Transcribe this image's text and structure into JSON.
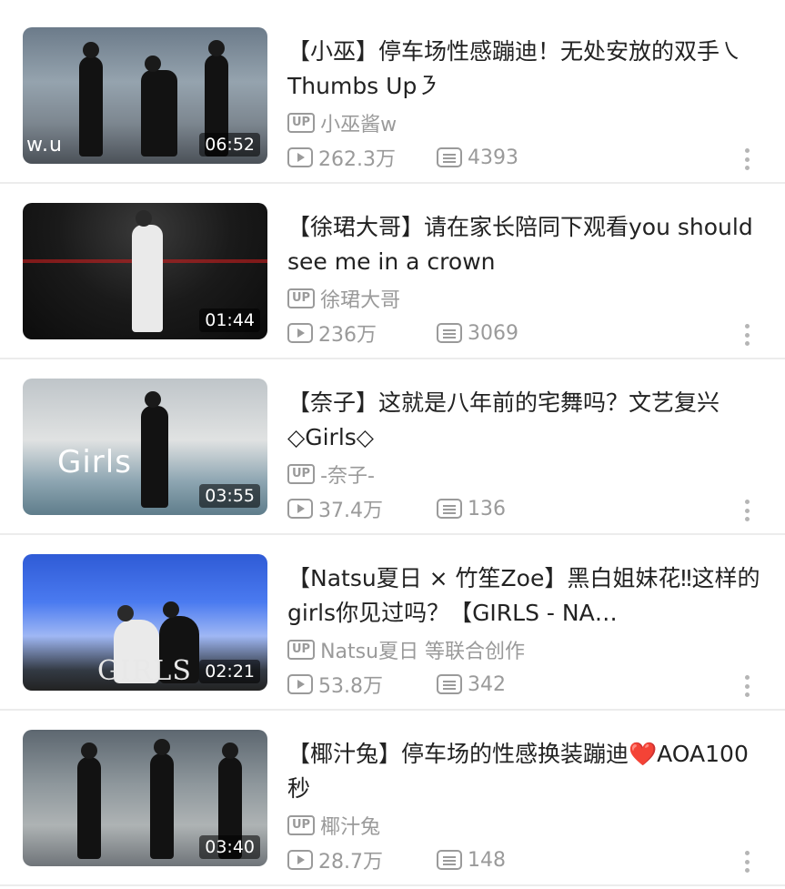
{
  "videos": [
    {
      "title": "【小巫】停车场性感蹦迪！无处安放的双手㇏Thumbs Up㇋",
      "uploader": "小巫酱w",
      "views": "262.3万",
      "danmaku": "4393",
      "duration": "06:52",
      "overlay": "w.u"
    },
    {
      "title": "【徐珺大哥】请在家长陪同下观看you should see me in a crown",
      "uploader": "徐珺大哥",
      "views": "236万",
      "danmaku": "3069",
      "duration": "01:44",
      "overlay": ""
    },
    {
      "title": "【奈子】这就是八年前的宅舞吗？文艺复兴◇Girls◇",
      "uploader": "-奈子-",
      "views": "37.4万",
      "danmaku": "136",
      "duration": "03:55",
      "overlay": "Girls"
    },
    {
      "title": "【Natsu夏日 × 竹笙Zoe】黑白姐妹花‼这样的girls你见过吗？【GIRLS - NA…",
      "uploader": "Natsu夏日 等联合创作",
      "views": "53.8万",
      "danmaku": "342",
      "duration": "02:21",
      "overlay": "GIRLS"
    },
    {
      "title": "【椰汁兔】停车场的性感换装蹦迪❤️AOA100秒",
      "uploader": "椰汁兔",
      "views": "28.7万",
      "danmaku": "148",
      "duration": "03:40",
      "overlay": ""
    }
  ],
  "up_badge": "UP",
  "icons": {
    "views": "play-count-icon",
    "danmaku": "danmaku-icon",
    "more": "more-vertical-icon"
  }
}
